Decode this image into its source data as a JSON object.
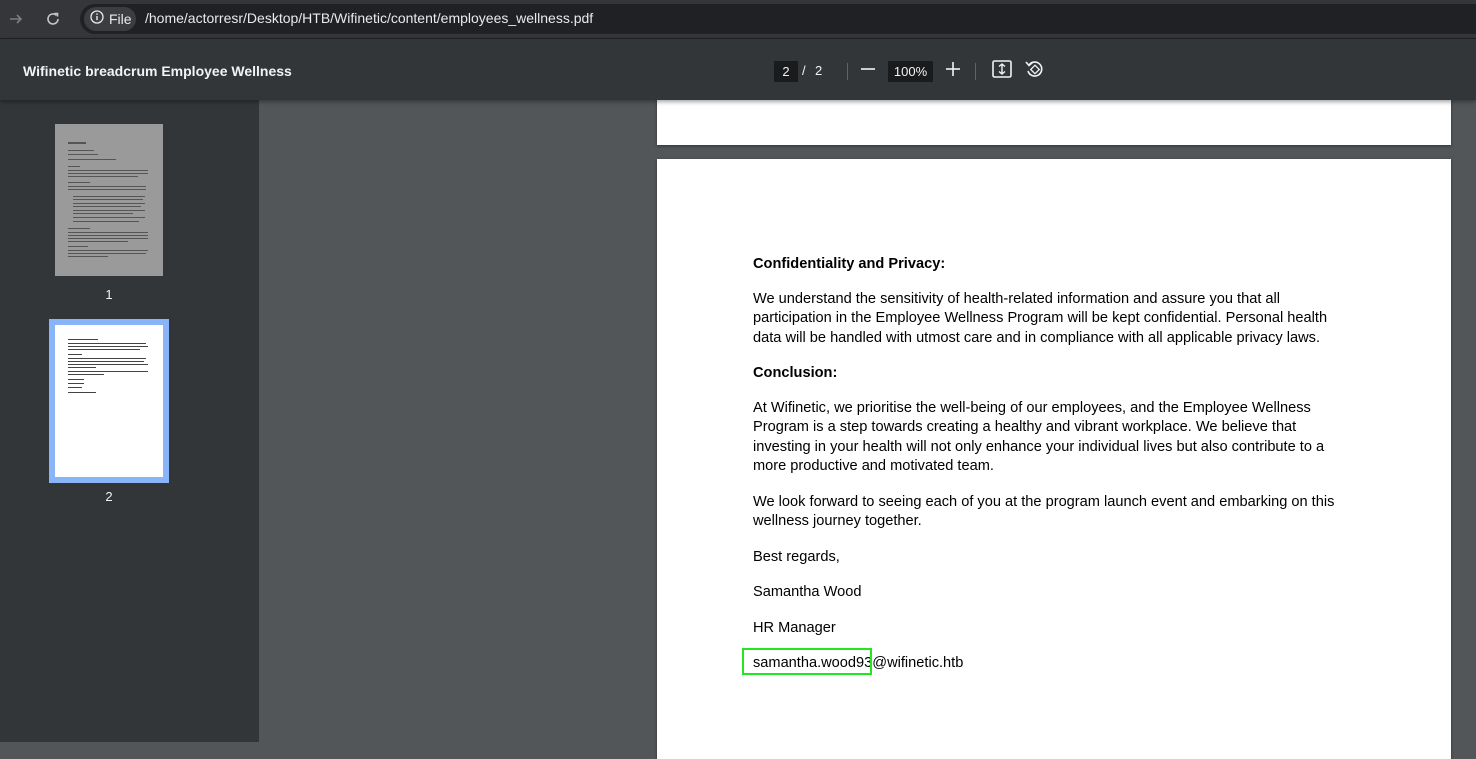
{
  "browser": {
    "chip_label": "File",
    "url": "/home/actorresr/Desktop/HTB/Wifinetic/content/employees_wellness.pdf"
  },
  "toolbar": {
    "title": "Wifinetic breadcrum Employee Wellness",
    "current_page": "2",
    "page_separator": "/",
    "total_pages": "2",
    "zoom": "100%"
  },
  "sidebar": {
    "thumbnails": [
      {
        "label": "1"
      },
      {
        "label": "2"
      }
    ]
  },
  "document": {
    "heading_privacy": "Confidentiality and Privacy:",
    "para_privacy": "We understand the sensitivity of health-related information and assure you that all participation in the Employee Wellness Program will be kept confidential. Personal health data will be handled with utmost care and in compliance with all applicable privacy laws.",
    "heading_conclusion": "Conclusion:",
    "para_conclusion": "At Wifinetic, we prioritise the well-being of our employees, and the Employee Wellness Program is a step towards creating a healthy and vibrant workplace. We believe that investing in your health will not only enhance your individual lives but also contribute to a more productive and motivated team.",
    "para_forward": "We look forward to seeing each of you at the program launch event and embarking on this wellness journey together.",
    "regards": "Best regards,",
    "name": "Samantha Wood",
    "role": "HR Manager",
    "email_user": "samantha.wood93",
    "email_domain": "@wifinetic.htb"
  },
  "colors": {
    "highlight": "#22e61f",
    "selected_thumb": "#8ab4f8"
  }
}
